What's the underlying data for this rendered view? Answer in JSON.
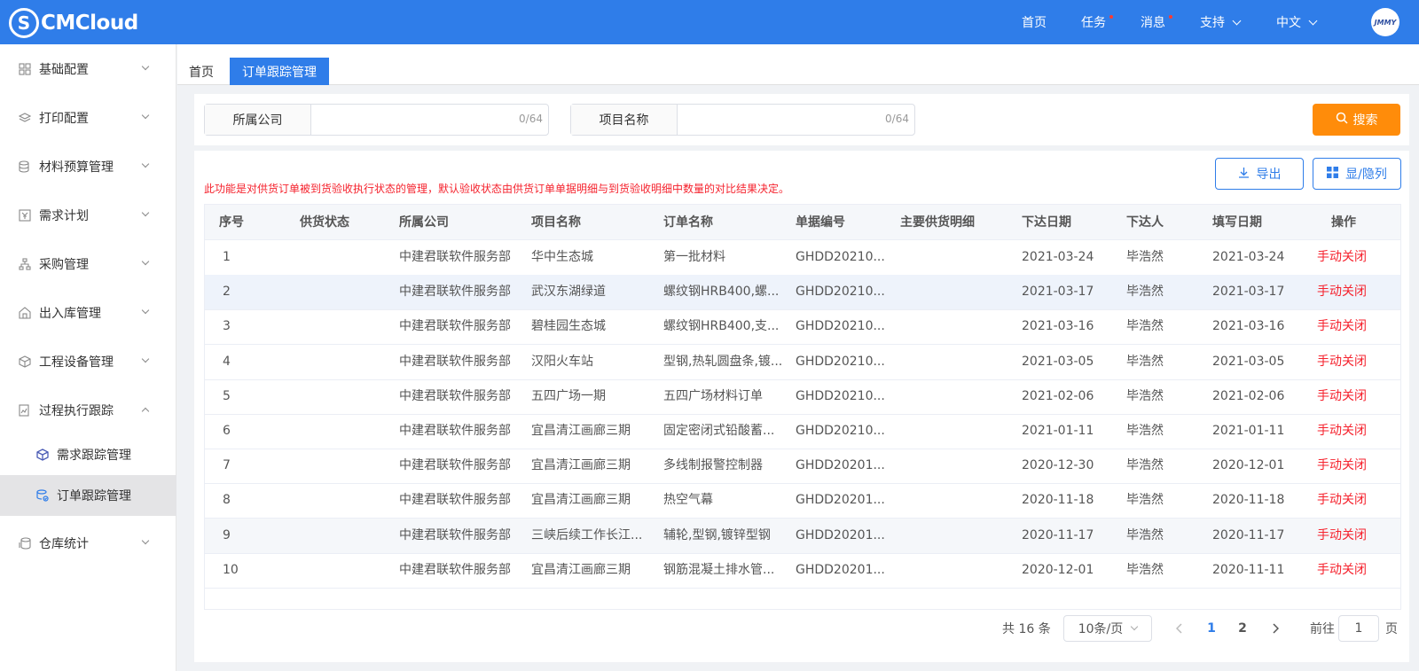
{
  "header": {
    "logo_text": "CMCloud",
    "nav": [
      {
        "label": "首页",
        "dot": false
      },
      {
        "label": "任务",
        "dot": true
      },
      {
        "label": "消息",
        "dot": true
      },
      {
        "label": "支持",
        "dot": false,
        "dropdown": true
      },
      {
        "label": "中文",
        "dot": false,
        "dropdown": true
      }
    ],
    "avatar_text": "JMMY"
  },
  "sidebar": {
    "items": [
      {
        "label": "基础配置",
        "icon": "grid-icon"
      },
      {
        "label": "打印配置",
        "icon": "layers-icon"
      },
      {
        "label": "材料预算管理",
        "icon": "database-icon"
      },
      {
        "label": "需求计划",
        "icon": "yen-icon"
      },
      {
        "label": "采购管理",
        "icon": "hierarchy-icon"
      },
      {
        "label": "出入库管理",
        "icon": "warehouse-icon"
      },
      {
        "label": "工程设备管理",
        "icon": "cube-icon"
      },
      {
        "label": "过程执行跟踪",
        "icon": "chart-doc-icon",
        "expanded": true
      },
      {
        "label": "仓库统计",
        "icon": "coins-icon"
      }
    ],
    "subitems": [
      {
        "label": "需求跟踪管理",
        "icon": "cube-icon"
      },
      {
        "label": "订单跟踪管理",
        "icon": "coins-check-icon",
        "active": true
      }
    ]
  },
  "tabs": [
    {
      "label": "首页",
      "active": false
    },
    {
      "label": "订单跟踪管理",
      "active": true
    }
  ],
  "search": {
    "company_label": "所属公司",
    "company_value": "",
    "company_count": "0/64",
    "project_label": "项目名称",
    "project_value": "",
    "project_count": "0/64",
    "search_button": "搜索"
  },
  "toolbar": {
    "export_label": "导出",
    "columns_label": "显/隐列"
  },
  "notice": "此功能是对供货订单被到货验收执行状态的管理，默认验收状态由供货订单单据明细与到货验收明细中数量的对比结果决定。",
  "table": {
    "headers": [
      "序号",
      "供货状态",
      "所属公司",
      "项目名称",
      "订单名称",
      "单据编号",
      "主要供货明细",
      "下达日期",
      "下达人",
      "填写日期",
      "操作"
    ],
    "rows": [
      [
        "1",
        "",
        "中建君联软件服务部",
        "华中生态城",
        "第一批材料",
        "GHDD20210...",
        "",
        "2021-03-24",
        "毕浩然",
        "2021-03-24",
        "手动关闭"
      ],
      [
        "2",
        "",
        "中建君联软件服务部",
        "武汉东湖绿道",
        "螺纹钢HRB400,螺...",
        "GHDD20210...",
        "",
        "2021-03-17",
        "毕浩然",
        "2021-03-17",
        "手动关闭"
      ],
      [
        "3",
        "",
        "中建君联软件服务部",
        "碧桂园生态城",
        "螺纹钢HRB400,支...",
        "GHDD20210...",
        "",
        "2021-03-16",
        "毕浩然",
        "2021-03-16",
        "手动关闭"
      ],
      [
        "4",
        "",
        "中建君联软件服务部",
        "汉阳火车站",
        "型钢,热轧圆盘条,镀...",
        "GHDD20210...",
        "",
        "2021-03-05",
        "毕浩然",
        "2021-03-05",
        "手动关闭"
      ],
      [
        "5",
        "",
        "中建君联软件服务部",
        "五四广场一期",
        "五四广场材料订单",
        "GHDD20210...",
        "",
        "2021-02-06",
        "毕浩然",
        "2021-02-06",
        "手动关闭"
      ],
      [
        "6",
        "",
        "中建君联软件服务部",
        "宜昌清江画廊三期",
        "固定密闭式铅酸蓄...",
        "GHDD20210...",
        "",
        "2021-01-11",
        "毕浩然",
        "2021-01-11",
        "手动关闭"
      ],
      [
        "7",
        "",
        "中建君联软件服务部",
        "宜昌清江画廊三期",
        "多线制报警控制器",
        "GHDD20201...",
        "",
        "2020-12-30",
        "毕浩然",
        "2020-12-01",
        "手动关闭"
      ],
      [
        "8",
        "",
        "中建君联软件服务部",
        "宜昌清江画廊三期",
        "热空气幕",
        "GHDD20201...",
        "",
        "2020-11-18",
        "毕浩然",
        "2020-11-18",
        "手动关闭"
      ],
      [
        "9",
        "",
        "中建君联软件服务部",
        "三峡后续工作长江...",
        "辅轮,型钢,镀锌型钢",
        "GHDD20201...",
        "",
        "2020-11-17",
        "毕浩然",
        "2020-11-17",
        "手动关闭"
      ],
      [
        "10",
        "",
        "中建君联软件服务部",
        "宜昌清江画廊三期",
        "钢筋混凝土排水管...",
        "GHDD20201...",
        "",
        "2020-12-01",
        "毕浩然",
        "2020-11-11",
        "手动关闭"
      ]
    ]
  },
  "pagination": {
    "total": "共 16 条",
    "page_size": "10条/页",
    "pages": [
      "1",
      "2"
    ],
    "current_page": "1",
    "goto_prefix": "前往",
    "goto_value": "1",
    "goto_suffix": "页"
  },
  "colors": {
    "primary": "#2f7de9",
    "search_button": "#ff8c0a",
    "danger": "#f5222d"
  }
}
